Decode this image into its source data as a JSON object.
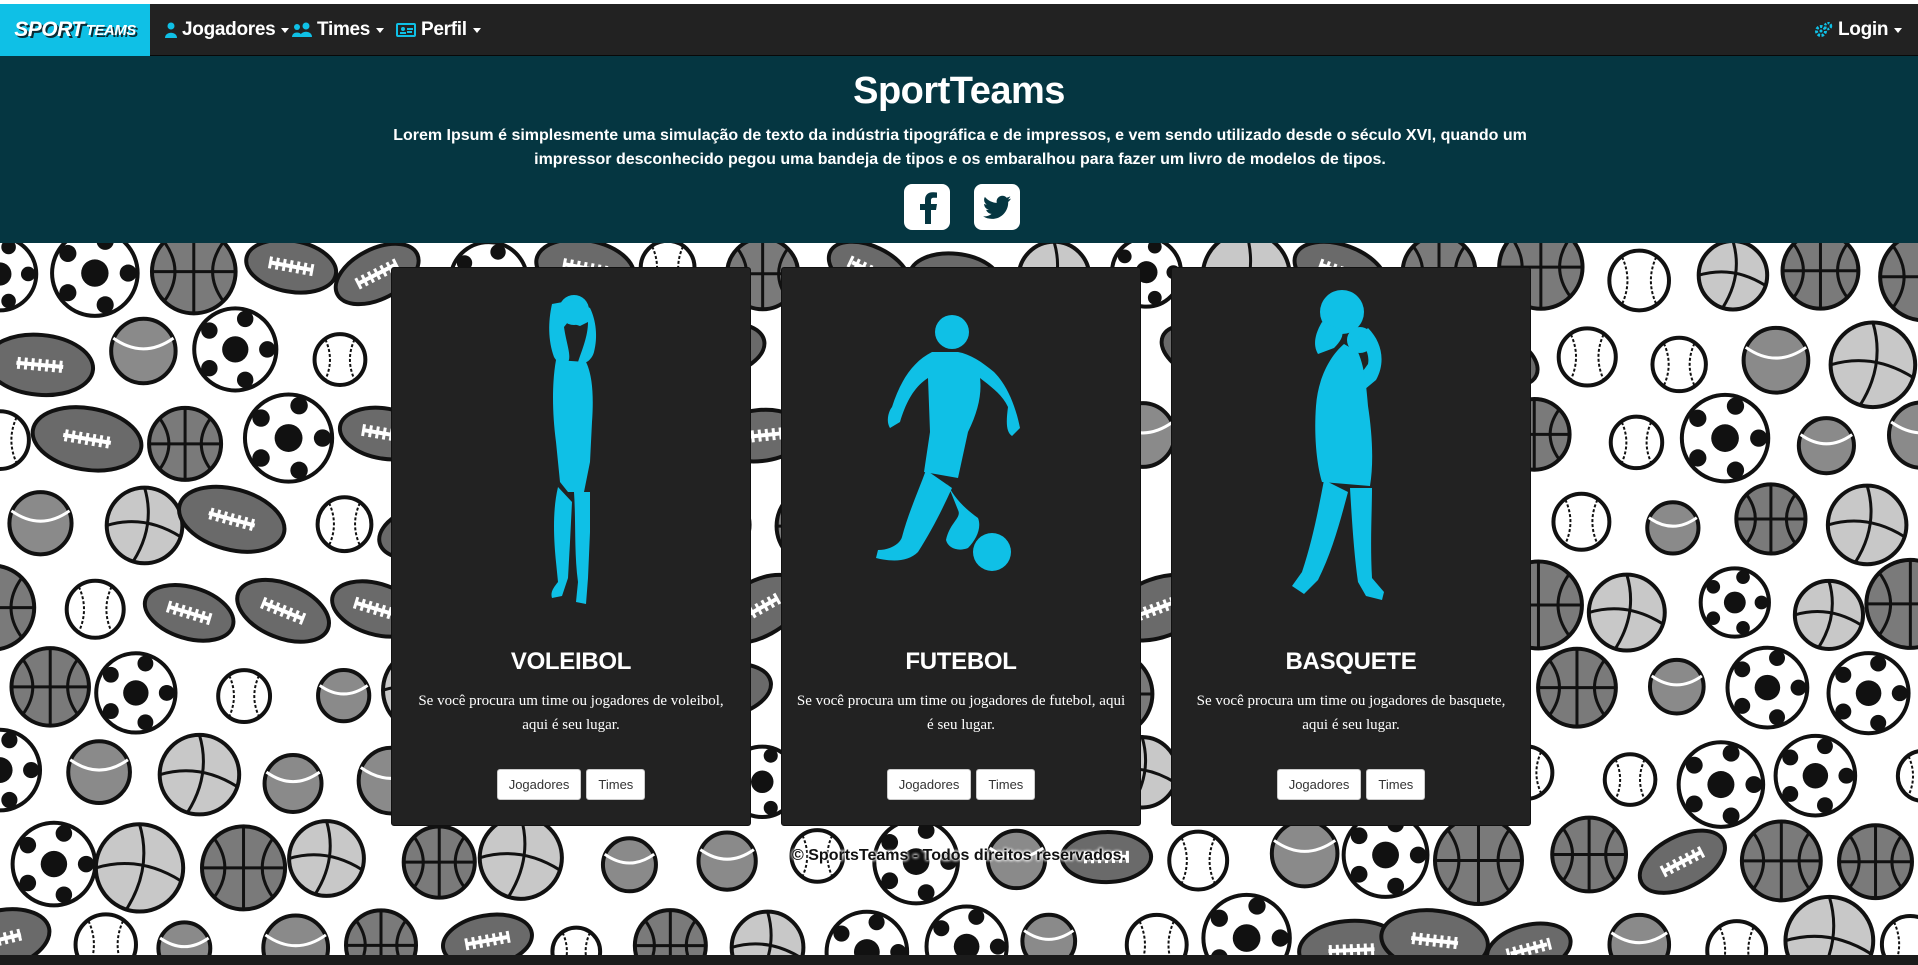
{
  "nav": {
    "brand_part1": "SPORT",
    "brand_part2": "TEAMS",
    "items": [
      {
        "label": "Jogadores",
        "icon": "user-icon"
      },
      {
        "label": "Times",
        "icon": "users-icon"
      },
      {
        "label": "Perfil",
        "icon": "id-card-icon"
      }
    ],
    "login_label": "Login",
    "login_icon": "gears-icon"
  },
  "header": {
    "title": "SportTeams",
    "lead": "Lorem Ipsum é simplesmente uma simulação de texto da indústria tipográfica e de impressos, e vem sendo utilizado desde o século XVI, quando um impressor desconhecido pegou uma bandeja de tipos e os embaralhou para fazer um livro de modelos de tipos.",
    "social": [
      "facebook-icon",
      "twitter-icon"
    ]
  },
  "cards": [
    {
      "title": "VOLEIBOL",
      "text": "Se você procura um time ou jogadores de voleibol, aqui é seu lugar.",
      "btn1": "Jogadores",
      "btn2": "Times"
    },
    {
      "title": "FUTEBOL",
      "text": "Se você procura um time ou jogadores de futebol, aqui é seu lugar.",
      "btn1": "Jogadores",
      "btn2": "Times"
    },
    {
      "title": "BASQUETE",
      "text": "Se você procura um time ou jogadores de basquete, aqui é seu lugar.",
      "btn1": "Jogadores",
      "btn2": "Times"
    }
  ],
  "footer": "© SportsTeams - Todos direitos reservados.",
  "colors": {
    "accent": "#0fc0e6",
    "header_bg": "#053641",
    "navbar_bg": "#222222",
    "card_bg": "#222222"
  }
}
